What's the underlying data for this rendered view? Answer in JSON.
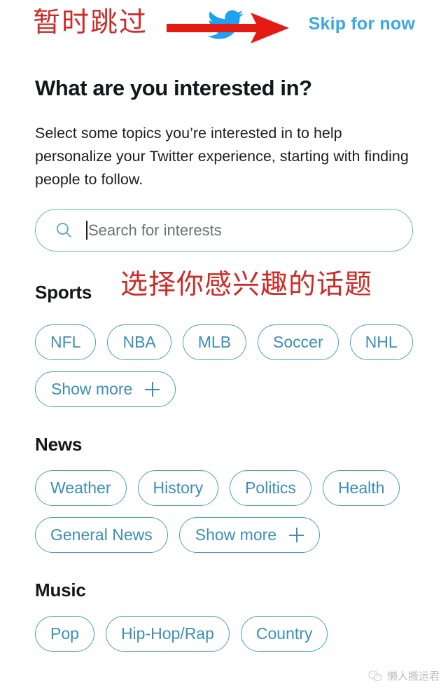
{
  "header": {
    "cn_skip_annotation": "暂时跳过",
    "skip_label": "Skip for now",
    "brand_icon": "twitter-bird-icon",
    "arrow_icon": "red-arrow-icon",
    "skip_color": "#3ba9dd",
    "annotation_color": "#cf2b26"
  },
  "main": {
    "title": "What are you interested in?",
    "description": "Select some topics you’re interested in to help personalize your Twitter experience, starting with finding people to follow.",
    "cn_topics_annotation": "选择你感兴趣的话题"
  },
  "search": {
    "placeholder": "Search for interests",
    "value": "",
    "icon": "search-icon"
  },
  "sections": [
    {
      "heading": "Sports",
      "rows": [
        [
          {
            "label": "NFL",
            "type": "topic"
          },
          {
            "label": "NBA",
            "type": "topic"
          },
          {
            "label": "MLB",
            "type": "topic"
          },
          {
            "label": "Soccer",
            "type": "topic"
          },
          {
            "label": "NHL",
            "type": "topic"
          }
        ],
        [
          {
            "label": "Show more",
            "type": "show-more"
          }
        ]
      ]
    },
    {
      "heading": "News",
      "rows": [
        [
          {
            "label": "Weather",
            "type": "topic"
          },
          {
            "label": "History",
            "type": "topic"
          },
          {
            "label": "Politics",
            "type": "topic"
          },
          {
            "label": "Health",
            "type": "topic"
          }
        ],
        [
          {
            "label": "General News",
            "type": "topic"
          },
          {
            "label": "Show more",
            "type": "show-more"
          }
        ]
      ]
    },
    {
      "heading": "Music",
      "rows": [
        [
          {
            "label": "Pop",
            "type": "topic"
          },
          {
            "label": "Hip-Hop/Rap",
            "type": "topic"
          },
          {
            "label": "Country",
            "type": "topic"
          }
        ]
      ]
    }
  ],
  "watermark": {
    "text": "懒人搬运君",
    "icon": "wechat-icon"
  },
  "theme": {
    "chip_border": "#49a0c0",
    "chip_text": "#3b8fb5",
    "twitter_blue": "#1da1f2"
  }
}
